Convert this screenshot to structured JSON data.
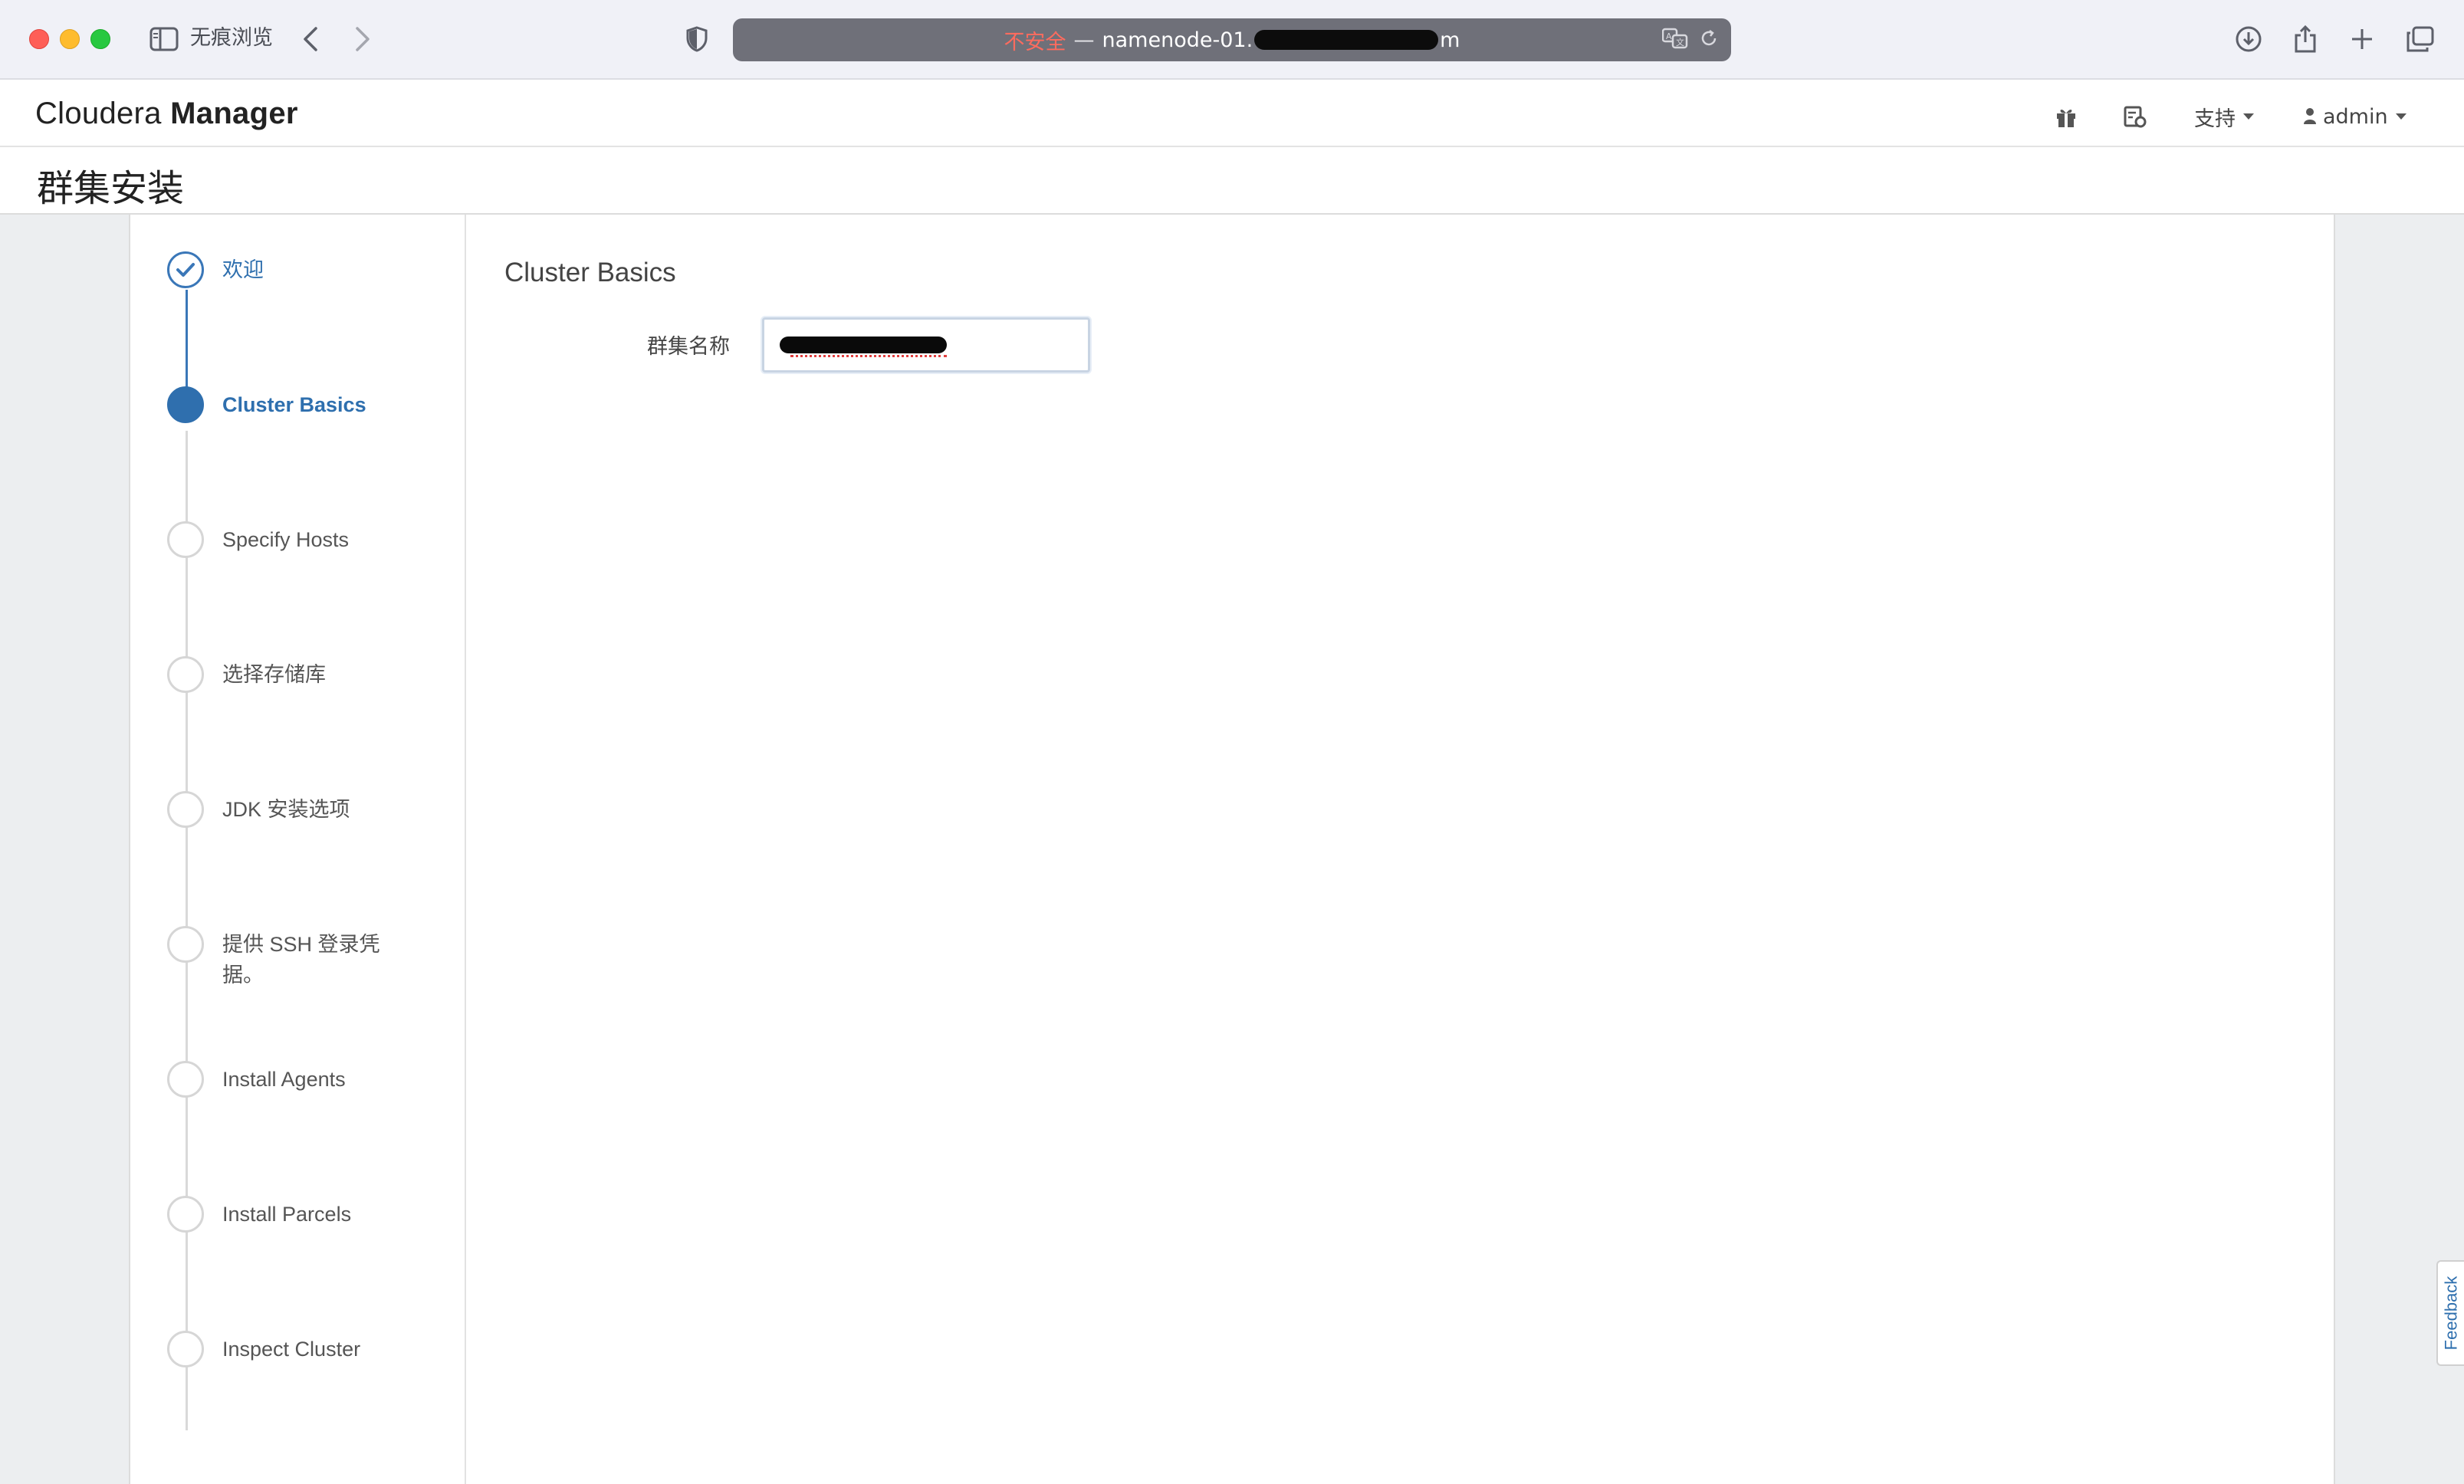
{
  "browser": {
    "incognito_label": "无痕浏览",
    "url_insecure": "不安全",
    "url_sep": "—",
    "url_start": "namenode-01.",
    "url_end": "m"
  },
  "header": {
    "brand_light": "Cloudera",
    "brand_bold": "Manager",
    "support_label": "支持",
    "user_label": "admin"
  },
  "page": {
    "title": "群集安装"
  },
  "steps": [
    {
      "label": "欢迎",
      "state": "done"
    },
    {
      "label": "Cluster Basics",
      "state": "active"
    },
    {
      "label": "Specify Hosts",
      "state": "pending"
    },
    {
      "label": "选择存储库",
      "state": "pending"
    },
    {
      "label": "JDK 安装选项",
      "state": "pending"
    },
    {
      "label": "提供 SSH 登录凭据。",
      "state": "pending"
    },
    {
      "label": "Install Agents",
      "state": "pending"
    },
    {
      "label": "Install Parcels",
      "state": "pending"
    },
    {
      "label": "Inspect Cluster",
      "state": "pending"
    }
  ],
  "main": {
    "section_title": "Cluster Basics",
    "cluster_name_label": "群集名称"
  },
  "feedback_label": "Feedback",
  "colors": {
    "accent": "#2f6fae",
    "insecure": "#ff6b5e"
  }
}
